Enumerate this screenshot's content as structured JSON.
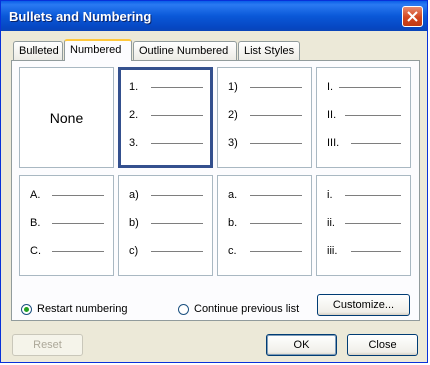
{
  "window": {
    "title": "Bullets and Numbering",
    "accent": "#0a58d8"
  },
  "tabs": [
    {
      "label": "Bulleted"
    },
    {
      "label": "Numbered"
    },
    {
      "label": "Outline Numbered"
    },
    {
      "label": "List Styles"
    }
  ],
  "active_tab": "Numbered",
  "gallery": {
    "none_label": "None",
    "selected_index": 1,
    "cells": [
      {
        "markers": []
      },
      {
        "markers": [
          "1.",
          "2.",
          "3."
        ]
      },
      {
        "markers": [
          "1)",
          "2)",
          "3)"
        ]
      },
      {
        "markers": [
          "I.",
          "II.",
          "III."
        ]
      },
      {
        "markers": [
          "A.",
          "B.",
          "C."
        ]
      },
      {
        "markers": [
          "a)",
          "b)",
          "c)"
        ]
      },
      {
        "markers": [
          "a.",
          "b.",
          "c."
        ]
      },
      {
        "markers": [
          "i.",
          "ii.",
          "iii."
        ]
      }
    ]
  },
  "options": {
    "restart_label": "Restart numbering",
    "continue_label": "Continue previous list",
    "restart_checked": true
  },
  "buttons": {
    "customize": "Customize...",
    "reset": "Reset",
    "ok": "OK",
    "cancel": "Close"
  }
}
